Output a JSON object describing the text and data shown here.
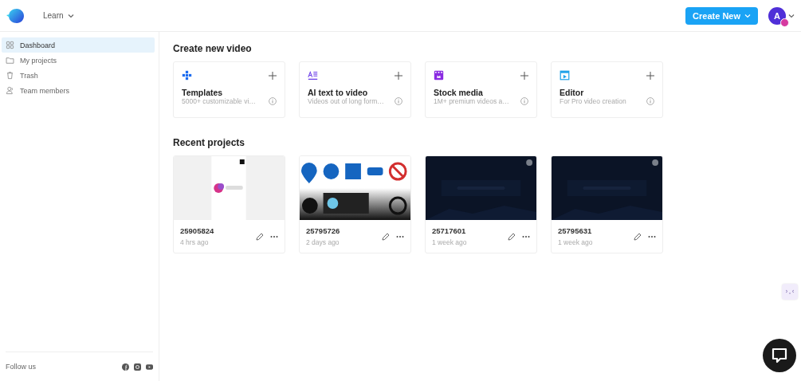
{
  "header": {
    "menu": "Learn",
    "create_button": "Create New",
    "avatar": "A"
  },
  "sidebar": {
    "items": [
      {
        "label": "Dashboard",
        "kind": "grid",
        "selected": true
      },
      {
        "label": "My projects",
        "kind": "folder",
        "selected": false
      },
      {
        "label": "Trash",
        "kind": "trash",
        "selected": false
      },
      {
        "label": "Team members",
        "kind": "people",
        "selected": false
      }
    ],
    "footer": "Follow us"
  },
  "create_section": {
    "title": "Create new video",
    "cards": [
      {
        "title": "Templates",
        "subtitle": "5000+ customizable vi…",
        "kind": "templates"
      },
      {
        "title": "AI text to video",
        "subtitle": "Videos out of long form…",
        "kind": "ai"
      },
      {
        "title": "Stock media",
        "subtitle": "1M+ premium videos a…",
        "kind": "stock"
      },
      {
        "title": "Editor",
        "subtitle": "For Pro video creation",
        "kind": "editor"
      }
    ]
  },
  "recent": {
    "title": "Recent projects",
    "projects": [
      {
        "name": "25905824",
        "time": "4 hrs ago",
        "kind": "light"
      },
      {
        "name": "25795726",
        "time": "2 days ago",
        "kind": "signs"
      },
      {
        "name": "25717601",
        "time": "1 week ago",
        "kind": "dark"
      },
      {
        "name": "25795631",
        "time": "1 week ago",
        "kind": "dark"
      }
    ]
  }
}
